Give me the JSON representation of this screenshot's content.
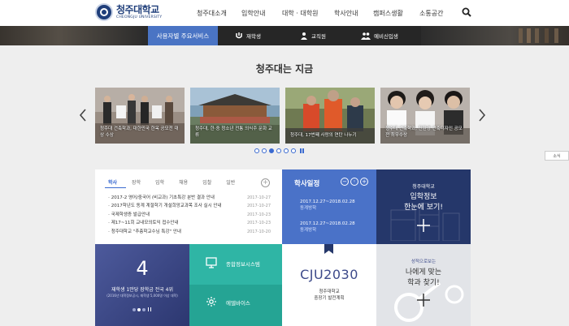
{
  "header": {
    "logo_ko": "청주대학교",
    "logo_en": "CHEONGJU UNIVERSITY",
    "nav": [
      "청주대소개",
      "입학안내",
      "대학 · 대학원",
      "학사안내",
      "캠퍼스생활",
      "소통공간"
    ]
  },
  "service_bar": {
    "main": "사용자별 주요서비스",
    "items": [
      "재학생",
      "교직원",
      "예비신입생"
    ]
  },
  "hero": {
    "title": "청주대는 지금",
    "slides": [
      "청주대 건축학과, 대한민국 한옥 공모전 대상 수상",
      "청주대, 한·중 청소년 전통 의식주 문화 교류",
      "청주대, 17번째 사랑의 연탄 나누기",
      "청주대 건축학과, 친환경 건축디자인 공모전 최우수상"
    ],
    "dots_total": 6,
    "dots_active_index": 2,
    "side_tab": "소식"
  },
  "notice": {
    "tabs": [
      "학사",
      "장학",
      "입학",
      "채용",
      "입찰",
      "일반"
    ],
    "active_tab": 0,
    "items": [
      {
        "title": "2017-2 영어/중국어 (비교과) 기초특강 분반 결과 안내",
        "date": "2017-10-27"
      },
      {
        "title": "2017학년도 동계 계절학기 개설희망교과목 조사 실시 안내",
        "date": "2017-10-27"
      },
      {
        "title": "국제학생증 발급안내",
        "date": "2017-10-23"
      },
      {
        "title": "제17~11회 교내모의토익 접수안내",
        "date": "2017-10-23"
      },
      {
        "title": "청주대학교 \"추층학교수님 특강\" 안내",
        "date": "2017-10-20"
      }
    ]
  },
  "schedule": {
    "title": "학사일정",
    "controls": [
      "−",
      "◦",
      "+"
    ],
    "events": [
      {
        "date": "2017.12.27~2018.02.28",
        "name": "동계방학"
      },
      {
        "date": "2017.12.27~2018.02.28",
        "name": "동계방학"
      }
    ]
  },
  "admission": {
    "small": "청주대학교",
    "line1": "입학정보",
    "line2": "한눈에 보기!"
  },
  "ranking": {
    "number": "4",
    "text": "재학생 1만당 장학금 전국 4위",
    "sub": "(2016년 대학정보공시, 재학생 5,000명 이상 대학)"
  },
  "systems": {
    "top": "종합정보시스템",
    "bottom": "에델바이스"
  },
  "plan": {
    "big": "CJU2030",
    "line1": "청주대학교",
    "line2": "중장기 발전계획"
  },
  "major": {
    "small": "성적으로보는",
    "line1": "나에게 맞는",
    "line2": "학과 찾기!"
  },
  "colors": {
    "brand_navy": "#25376a",
    "accent_blue": "#4a72c8",
    "teal": "#2fb5a5"
  }
}
